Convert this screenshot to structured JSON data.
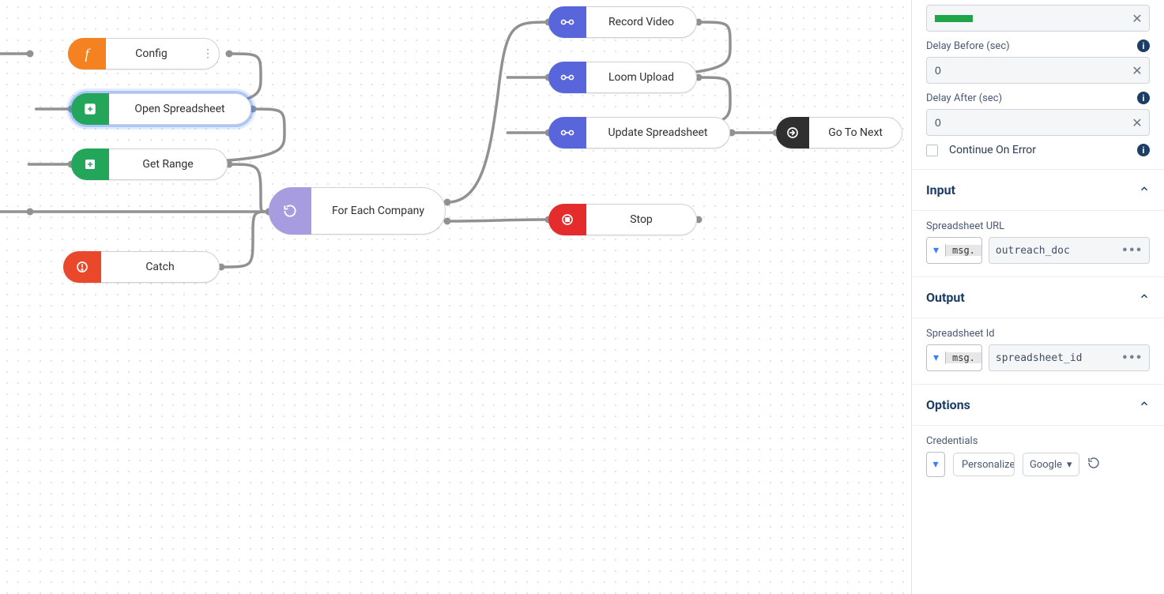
{
  "nodes": {
    "config": "Config",
    "openSpreadsheet": "Open Spreadsheet",
    "getRange": "Get Range",
    "forEach": "For Each Company",
    "catch": "Catch",
    "recordVideo": "Record Video",
    "loomUpload": "Loom Upload",
    "updateSpreadsheet": "Update Spreadsheet",
    "goToNext": "Go To Next",
    "stop": "Stop"
  },
  "panel": {
    "delayBeforeLabel": "Delay Before (sec)",
    "delayBeforeValue": "0",
    "delayAfterLabel": "Delay After (sec)",
    "delayAfterValue": "0",
    "continueOnError": "Continue On Error",
    "inputTitle": "Input",
    "spreadsheetUrlLabel": "Spreadsheet URL",
    "spreadsheetUrlValue": "outreach_doc",
    "msgPrefix": "msg.",
    "outputTitle": "Output",
    "spreadsheetIdLabel": "Spreadsheet Id",
    "spreadsheetIdValue": "spreadsheet_id",
    "optionsTitle": "Options",
    "credentialsLabel": "Credentials",
    "credPersonalize": "Personalize",
    "credGoogle": "Google"
  }
}
